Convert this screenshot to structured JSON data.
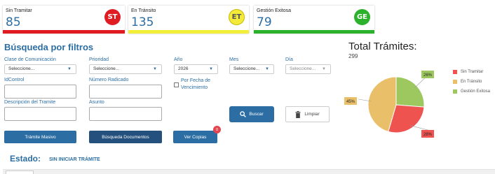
{
  "status_cards": {
    "sin_tramitar": {
      "label": "Sin Tramitar",
      "count": "85",
      "badge": "ST",
      "color": "#e11b22"
    },
    "en_transito": {
      "label": "En Tránsito",
      "count": "135",
      "badge": "ET",
      "color": "#f2ee3a"
    },
    "gestion_exitosa": {
      "label": "Gestión Exitosa",
      "count": "79",
      "badge": "GE",
      "color": "#2bb12b"
    }
  },
  "search": {
    "title": "Búsqueda por filtros",
    "clase_label": "Clase de Comunicación",
    "clase_value": "Seleccione...",
    "prioridad_label": "Prioridad",
    "prioridad_value": "Seleccione...",
    "anio_label": "Año",
    "anio_value": "2026",
    "mes_label": "Mes",
    "mes_value": "Seleccione...",
    "dia_label": "Día",
    "dia_value": "Seleccione...",
    "idcontrol_label": "IdControl",
    "radicado_label": "Número Radicado",
    "fecha_venc_label": "Por Fecha de Vencimiento",
    "descripcion_label": "Descripción del Tramite",
    "asunto_label": "Asunto",
    "buscar_label": "Buscar",
    "limpiar_label": "Limpiar"
  },
  "actions": {
    "masivo_label": "Trámite Masivo",
    "busqueda_docs_label": "Búsqueda Documentos",
    "copias_label": "Ver Copias",
    "copias_count": "0"
  },
  "estado": {
    "label": "Estado:",
    "value": "SIN INICIAR TRÁMITE"
  },
  "chart_data": {
    "type": "pie",
    "title": "Total Trámites:",
    "subtitle": "299",
    "categories": [
      "Sin Tramitar",
      "En Tránsito",
      "Gestión Exitosa"
    ],
    "values": [
      28,
      45,
      26
    ],
    "labels": [
      "28%",
      "45%",
      "26%"
    ],
    "colors": [
      "#ef5350",
      "#e9c069",
      "#9dc75f"
    ],
    "legend": "right"
  }
}
